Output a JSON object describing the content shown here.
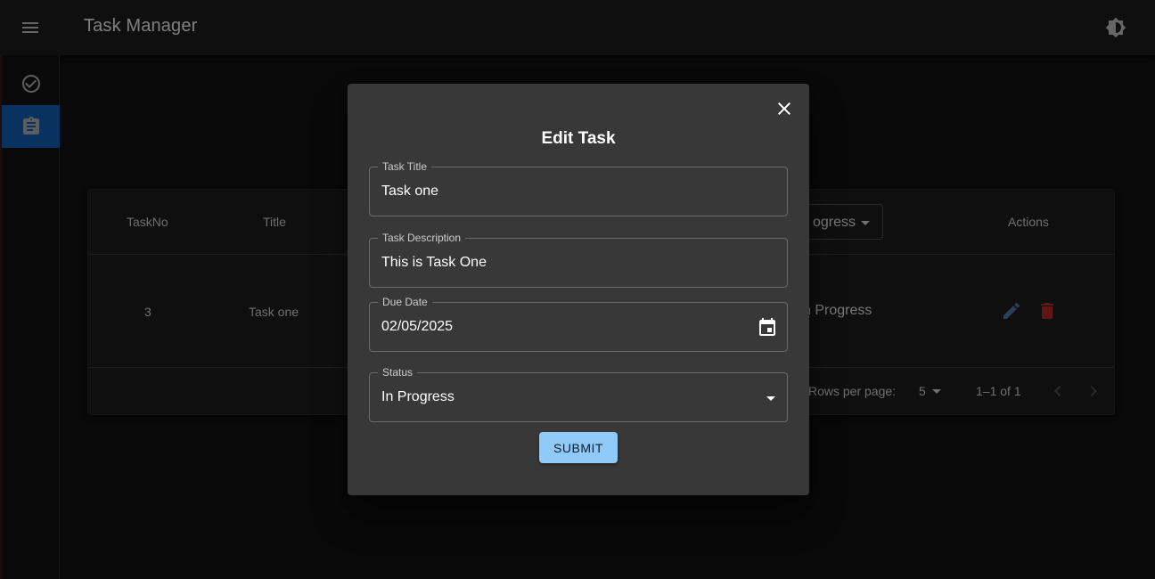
{
  "app": {
    "title": "Task Manager"
  },
  "icons": {
    "menu": "menu-icon",
    "theme": "brightness-icon",
    "tasks_nav": "check-circle-icon",
    "assignment_nav": "assignment-icon",
    "edit": "edit-icon",
    "delete": "delete-icon",
    "close": "close-icon",
    "calendar": "calendar-icon"
  },
  "colors": {
    "accent": "#90caf9",
    "nav_active": "#1565c0",
    "delete": "#c62828",
    "edit": "#5b7fb0"
  },
  "table": {
    "headers": {
      "task_no": "TaskNo",
      "title": "Title",
      "status_filter": "ogress",
      "actions": "Actions"
    },
    "rows": [
      {
        "task_no": "3",
        "title": "Task one",
        "status": "n Progress"
      }
    ],
    "footer": {
      "rows_per_page_label": "Rows per page:",
      "rows_per_page_value": "5",
      "range": "1–1 of 1"
    }
  },
  "dialog": {
    "title": "Edit Task",
    "fields": {
      "task_title": {
        "label": "Task Title",
        "value": "Task one"
      },
      "task_description": {
        "label": "Task Description",
        "value": "This is Task One"
      },
      "due_date": {
        "label": "Due Date",
        "value": "02/05/2025"
      },
      "status": {
        "label": "Status",
        "value": "In Progress"
      }
    },
    "submit_label": "SUBMIT"
  }
}
